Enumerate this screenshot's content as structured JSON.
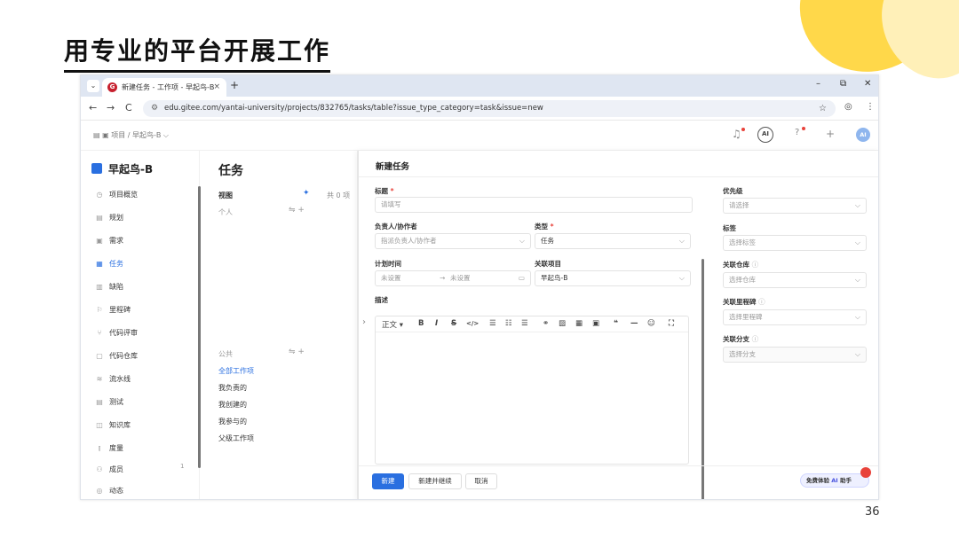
{
  "slide": {
    "title": "用专业的平台开展工作",
    "page_number": "36"
  },
  "browser": {
    "tab_title": "新建任务 - 工作项 - 早起鸟-B",
    "tab_favicon": "gitee-logo",
    "tab_close": "×",
    "new_tab": "+",
    "tab_dropdown": "⌄",
    "window_controls": {
      "minimize": "–",
      "restore": "⧉",
      "close": "✕"
    },
    "nav": {
      "back": "←",
      "forward": "→",
      "reload": "C"
    },
    "url": "edu.gitee.com/yantai-university/projects/832765/tasks/table?issue_type_category=task&issue=new",
    "url_tune": "⚙",
    "bookmark": "☆",
    "profile": "◎",
    "menu": "⋮"
  },
  "appbar": {
    "breadcrumb": "▤   ▣ 项目  /  早起鸟-B  ⌵",
    "bell": "♫",
    "ai": "AI",
    "help": "?",
    "add": "+",
    "avatar": "AI"
  },
  "sidebar": {
    "project": "早起鸟-B",
    "items": [
      {
        "icon": "◷",
        "label": "项目概览"
      },
      {
        "icon": "▤",
        "label": "规划"
      },
      {
        "icon": "▣",
        "label": "需求"
      },
      {
        "icon": "▦",
        "label": "任务"
      },
      {
        "icon": "▥",
        "label": "缺陷"
      },
      {
        "icon": "⚐",
        "label": "里程碑"
      },
      {
        "icon": "⑂",
        "label": "代码评审"
      },
      {
        "icon": "▢",
        "label": "代码仓库"
      },
      {
        "icon": "≋",
        "label": "流水线"
      },
      {
        "icon": "▤",
        "label": "测试"
      },
      {
        "icon": "◫",
        "label": "知识库"
      },
      {
        "icon": "⫾",
        "label": "度量"
      },
      {
        "icon": "⚇",
        "label": "成员"
      },
      {
        "icon": "◎",
        "label": "动态"
      }
    ],
    "members_count": "1"
  },
  "views": {
    "title": "任务",
    "view_label": "视图",
    "total": "共 0 项",
    "personal": "个人",
    "public": "公共",
    "public_items": [
      "全部工作项",
      "我负责的",
      "我创建的",
      "我参与的",
      "父级工作项"
    ]
  },
  "modal": {
    "title": "新建任务",
    "title_label": "标题",
    "title_placeholder": "请填写",
    "assignee_label": "负责人/协作者",
    "assignee_placeholder": "指派负责人/协作者",
    "type_label": "类型",
    "type_value": "任务",
    "plan_label": "计划时间",
    "plan_start": "未设置",
    "plan_end": "未设置",
    "project_label": "关联项目",
    "project_value": "早起鸟-B",
    "desc_label": "描述",
    "toolbar": {
      "paragraph": "正文 ▾",
      "bold": "B",
      "italic": "I",
      "strike": "S",
      "code": "</>",
      "bullet": "☰",
      "ordered": "☷",
      "task": "☰",
      "link": "⚭",
      "image": "▨",
      "table": "▦",
      "video": "▣",
      "quote": "❝",
      "hr": "—",
      "emoji": "☺",
      "fullscreen": "⛶"
    },
    "priority_label": "优先级",
    "priority_placeholder": "请选择",
    "tags_label": "标签",
    "tags_placeholder": "选择标签",
    "repo_label": "关联仓库",
    "repo_placeholder": "选择仓库",
    "milestone_label": "关联里程碑",
    "milestone_placeholder": "选择里程碑",
    "branch_label": "关联分支",
    "branch_placeholder": "选择分支",
    "create_btn": "新建",
    "create_continue_btn": "新建并继续",
    "cancel_btn": "取消",
    "ai_helper": "免费体验",
    "ai_helper_ai": "AI",
    "ai_helper_suffix": "助手"
  },
  "colors": {
    "accent": "#2a6fe0",
    "deco": "#ffd84a",
    "required": "#e8423a"
  }
}
